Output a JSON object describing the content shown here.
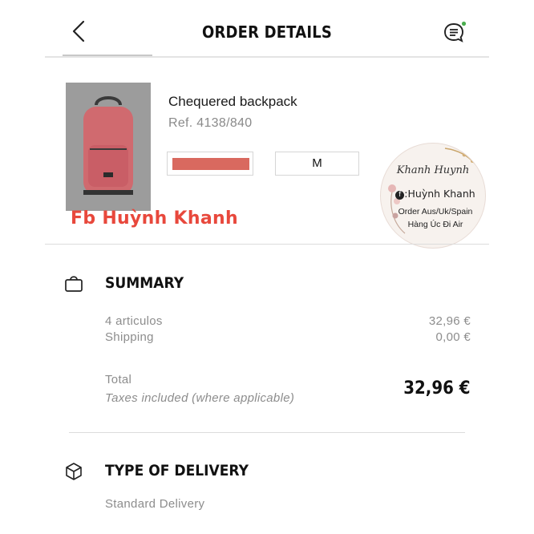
{
  "header": {
    "title": "ORDER DETAILS",
    "chat_badge_color": "#4caf50"
  },
  "product": {
    "name": "Chequered backpack",
    "ref": "Ref.  4138/840",
    "color_swatch": "#d9695f",
    "size": "M"
  },
  "watermark": {
    "overlay_text": "Fb Huỳnh Khanh",
    "seal_script": "Khanh Huynh",
    "seal_fb": "Huỳnh Khanh",
    "seal_line1": "Order Aus/Uk/Spain",
    "seal_line2": "Hàng Úc Đi Air"
  },
  "summary": {
    "title": "SUMMARY",
    "items_label": "4 articulos",
    "items_value": "32,96 €",
    "shipping_label": "Shipping",
    "shipping_value": "0,00 €",
    "total_label": "Total",
    "taxes_note": "Taxes included (where applicable)",
    "total_value": "32,96 €"
  },
  "delivery": {
    "title": "TYPE OF DELIVERY",
    "value": "Standard Delivery"
  },
  "icons": {
    "back": "chevron-left-icon",
    "chat": "chat-icon",
    "bag": "shopping-bag-icon",
    "box": "package-icon"
  }
}
